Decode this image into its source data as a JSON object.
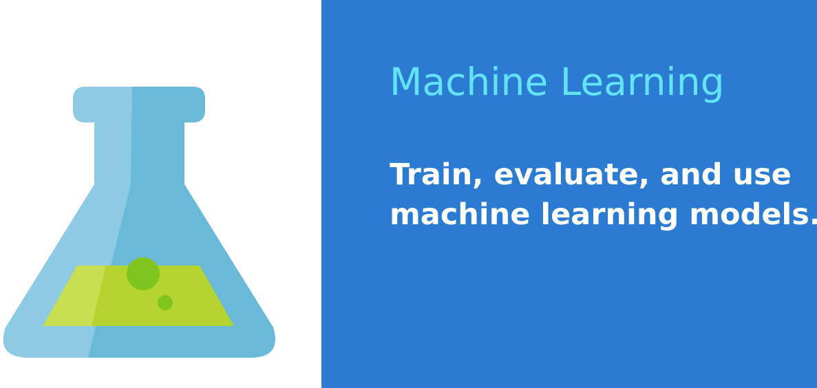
{
  "slide": {
    "title": "Machine Learning",
    "subtitle_line1": "Train, evaluate, and use",
    "subtitle_line2": "machine learning models."
  },
  "flask": {
    "icon": "lab-flask-icon",
    "glass_color": "#8ccbe3",
    "glass_shade_color": "#6bb9d9",
    "liquid_color": "#c8df52",
    "liquid_shade_color": "#b5d42f",
    "bubble_color": "#7fc41f"
  },
  "colors": {
    "panel_background": "#2b7bd2",
    "title_color": "#62e3f6",
    "subtitle_color": "#ffffff"
  }
}
